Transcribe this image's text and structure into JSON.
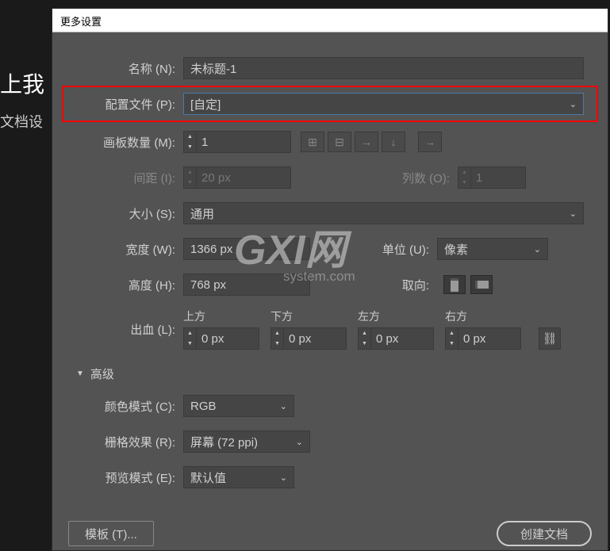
{
  "background": {
    "text1": "上我",
    "text2": "文档设"
  },
  "dialog": {
    "title": "更多设置"
  },
  "fields": {
    "name_label": "名称 (N):",
    "name_value": "未标题-1",
    "profile_label": "配置文件 (P):",
    "profile_value": "[自定]",
    "artboards_label": "画板数量 (M):",
    "artboards_value": "1",
    "spacing_label": "间距 (I):",
    "spacing_value": "20 px",
    "columns_label": "列数 (O):",
    "columns_value": "1",
    "size_label": "大小 (S):",
    "size_value": "通用",
    "width_label": "宽度 (W):",
    "width_value": "1366 px",
    "units_label": "单位 (U):",
    "units_value": "像素",
    "height_label": "高度 (H):",
    "height_value": "768 px",
    "orient_label": "取向:",
    "bleed_label": "出血 (L):",
    "bleed_top": "上方",
    "bleed_bottom": "下方",
    "bleed_left": "左方",
    "bleed_right": "右方",
    "bleed_value": "0 px",
    "advanced": "高级",
    "color_label": "颜色模式 (C):",
    "color_value": "RGB",
    "raster_label": "栅格效果 (R):",
    "raster_value": "屏幕 (72 ppi)",
    "preview_label": "预览模式 (E):",
    "preview_value": "默认值"
  },
  "buttons": {
    "template": "模板 (T)...",
    "create": "创建文档"
  },
  "watermark": {
    "main": "GXI网",
    "sub": "system.com"
  }
}
